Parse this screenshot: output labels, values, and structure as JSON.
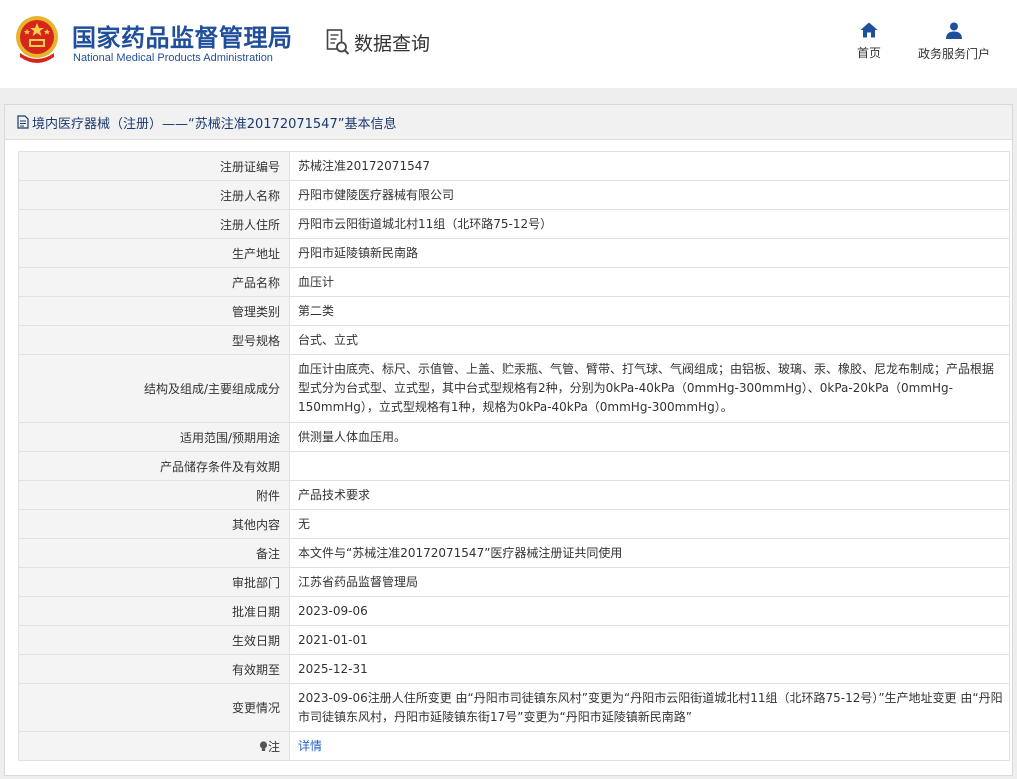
{
  "header": {
    "org_cn": "国家药品监督管理局",
    "org_en": "National Medical Products Administration",
    "query_label": "数据查询",
    "nav": [
      {
        "label": "首页",
        "icon": "home-icon"
      },
      {
        "label": "政务服务门户",
        "icon": "user-icon"
      }
    ]
  },
  "panel": {
    "title": "境内医疗器械（注册）——“苏械注准20172071547”基本信息"
  },
  "colors": {
    "brand": "#1f4f9a",
    "link": "#2a62c9",
    "label_bg": "#f4f4f4"
  },
  "rows": [
    {
      "label": "注册证编号",
      "value": "苏械注准20172071547"
    },
    {
      "label": "注册人名称",
      "value": "丹阳市健陵医疗器械有限公司"
    },
    {
      "label": "注册人住所",
      "value": "丹阳市云阳街道城北村11组（北环路75-12号）"
    },
    {
      "label": "生产地址",
      "value": "丹阳市延陵镇新民南路"
    },
    {
      "label": "产品名称",
      "value": "血压计"
    },
    {
      "label": "管理类别",
      "value": "第二类"
    },
    {
      "label": "型号规格",
      "value": "台式、立式"
    },
    {
      "label": "结构及组成/主要组成成分",
      "value": "血压计由底壳、标尺、示值管、上盖、贮汞瓶、气管、臂带、打气球、气阀组成；由铝板、玻璃、汞、橡胶、尼龙布制成；产品根据型式分为台式型、立式型，其中台式型规格有2种，分别为0kPa-40kPa（0mmHg-300mmHg）、0kPa-20kPa（0mmHg-150mmHg），立式型规格有1种，规格为0kPa-40kPa（0mmHg-300mmHg）。"
    },
    {
      "label": "适用范围/预期用途",
      "value": "供测量人体血压用。"
    },
    {
      "label": "产品储存条件及有效期",
      "value": ""
    },
    {
      "label": "附件",
      "value": "产品技术要求"
    },
    {
      "label": "其他内容",
      "value": "无"
    },
    {
      "label": "备注",
      "value": "本文件与“苏械注准20172071547”医疗器械注册证共同使用"
    },
    {
      "label": "审批部门",
      "value": "江苏省药品监督管理局"
    },
    {
      "label": "批准日期",
      "value": "2023-09-06"
    },
    {
      "label": "生效日期",
      "value": "2021-01-01"
    },
    {
      "label": "有效期至",
      "value": "2025-12-31"
    },
    {
      "label": "变更情况",
      "value": "2023-09-06注册人住所变更 由“丹阳市司徒镇东风村”变更为“丹阳市云阳街道城北村11组（北环路75-12号）”生产地址变更 由“丹阳市司徒镇东风村，丹阳市延陵镇东街17号”变更为“丹阳市延陵镇新民南路”"
    },
    {
      "label": "注",
      "value": "详情",
      "icon": "bulb-icon"
    }
  ]
}
